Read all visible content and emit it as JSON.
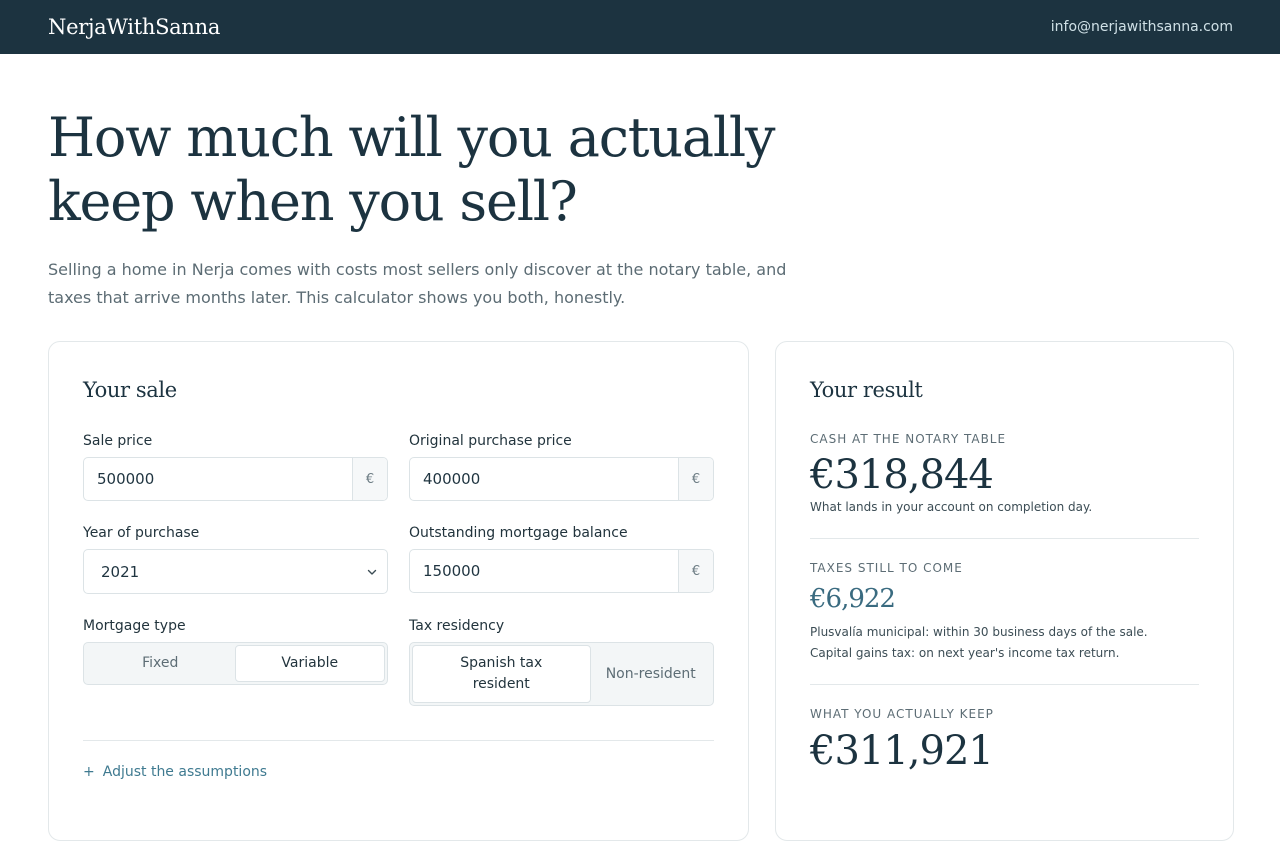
{
  "header": {
    "brand": "NerjaWithSanna",
    "email": "info@nerjawithsanna.com"
  },
  "hero": {
    "headline": "How much will you actually keep when you sell?",
    "intro": "Selling a home in Nerja comes with costs most sellers only discover at the notary table, and taxes that arrive months later. This calculator shows you both, honestly."
  },
  "sale": {
    "title": "Your sale",
    "sale_price": {
      "label": "Sale price",
      "value": "500000",
      "suffix": "€"
    },
    "purchase_price": {
      "label": "Original purchase price",
      "value": "400000",
      "suffix": "€"
    },
    "year": {
      "label": "Year of purchase",
      "value": "2021"
    },
    "mortgage_balance": {
      "label": "Outstanding mortgage balance",
      "value": "150000",
      "suffix": "€"
    },
    "mortgage_type": {
      "label": "Mortgage type",
      "options": [
        "Fixed",
        "Variable"
      ],
      "selected": "Variable"
    },
    "tax_residency": {
      "label": "Tax residency",
      "options": [
        "Spanish tax resident",
        "Non-resident"
      ],
      "selected": "Spanish tax resident"
    },
    "adjust_label": "Adjust the assumptions",
    "adjust_icon": "+"
  },
  "result": {
    "title": "Your result",
    "cash": {
      "label": "CASH AT THE NOTARY TABLE",
      "value": "€318,844",
      "note": "What lands in your account on completion day."
    },
    "taxes": {
      "label": "TAXES STILL TO COME",
      "value": "€6,922",
      "note1": "Plusvalía municipal: within 30 business days of the sale.",
      "note2": "Capital gains tax: on next year's income tax return."
    },
    "keep": {
      "label": "WHAT YOU ACTUALLY KEEP",
      "value": "€311,921"
    }
  },
  "colors": {
    "header_bg": "#1c3340",
    "accent": "#3f7a90",
    "taxes_value": "#3a6b80"
  }
}
